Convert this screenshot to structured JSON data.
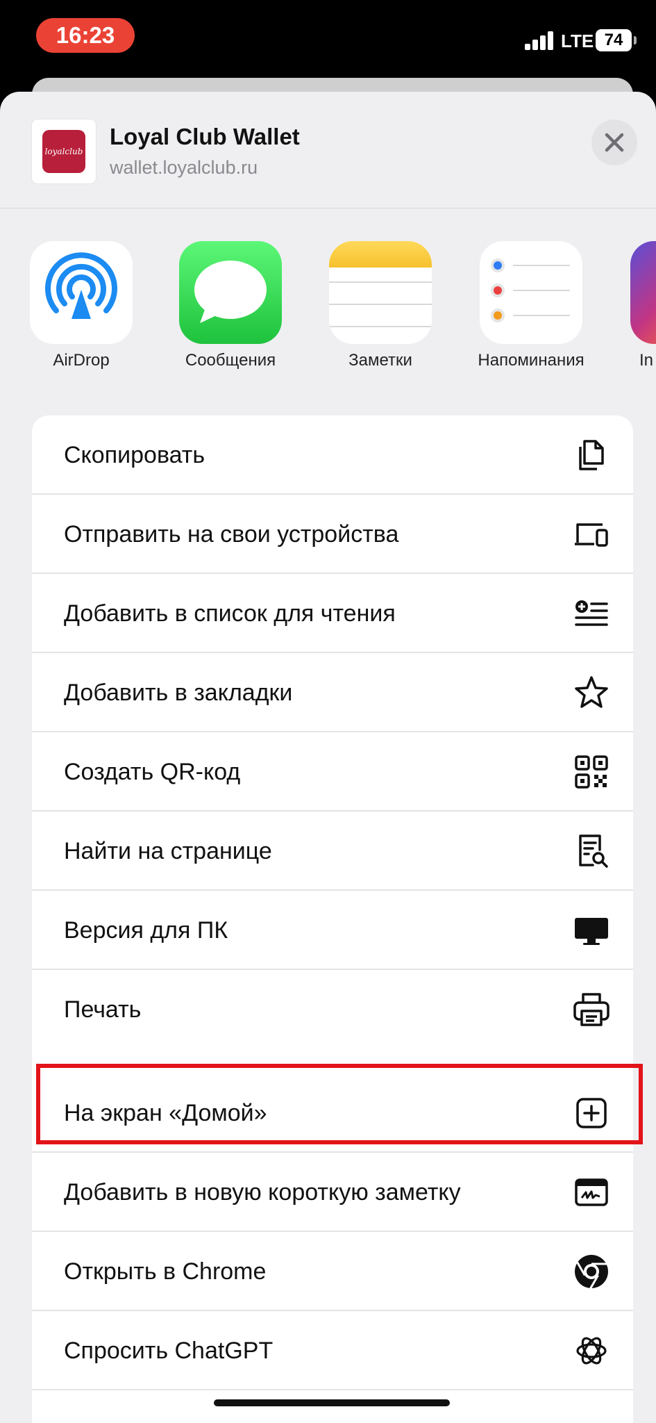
{
  "status_bar": {
    "time": "16:23",
    "network": "LTE",
    "battery": "74",
    "time_pill_color": "#ea4335"
  },
  "share_header": {
    "site_title": "Loyal Club Wallet",
    "site_url": "wallet.loyalclub.ru",
    "site_icon_text": "loyalclub",
    "brand_color": "#b81f3a"
  },
  "apps": [
    {
      "label": "AirDrop",
      "icon": "airdrop-icon"
    },
    {
      "label": "Сообщения",
      "icon": "messages-icon"
    },
    {
      "label": "Заметки",
      "icon": "notes-icon"
    },
    {
      "label": "Напоминания",
      "icon": "reminders-icon"
    },
    {
      "label": "In",
      "icon": "instagram-icon"
    }
  ],
  "actions_group1": [
    {
      "label": "Скопировать",
      "icon": "copy-icon"
    },
    {
      "label": "Отправить на свои устройства",
      "icon": "devices-icon"
    },
    {
      "label": "Добавить в список для чтения",
      "icon": "reading-list-icon"
    },
    {
      "label": "Добавить в закладки",
      "icon": "star-icon"
    },
    {
      "label": "Создать QR-код",
      "icon": "qr-code-icon"
    },
    {
      "label": "Найти на странице",
      "icon": "find-on-page-icon"
    },
    {
      "label": "Версия для ПК",
      "icon": "desktop-icon"
    },
    {
      "label": "Печать",
      "icon": "printer-icon"
    }
  ],
  "actions_group2": [
    {
      "label": "На экран «Домой»",
      "icon": "add-square-icon"
    },
    {
      "label": "Добавить в новую короткую заметку",
      "icon": "quick-note-icon"
    },
    {
      "label": "Открыть в Chrome",
      "icon": "chrome-icon"
    },
    {
      "label": "Спросить ChatGPT",
      "icon": "chatgpt-icon"
    }
  ],
  "highlight_color": "#e3131a"
}
